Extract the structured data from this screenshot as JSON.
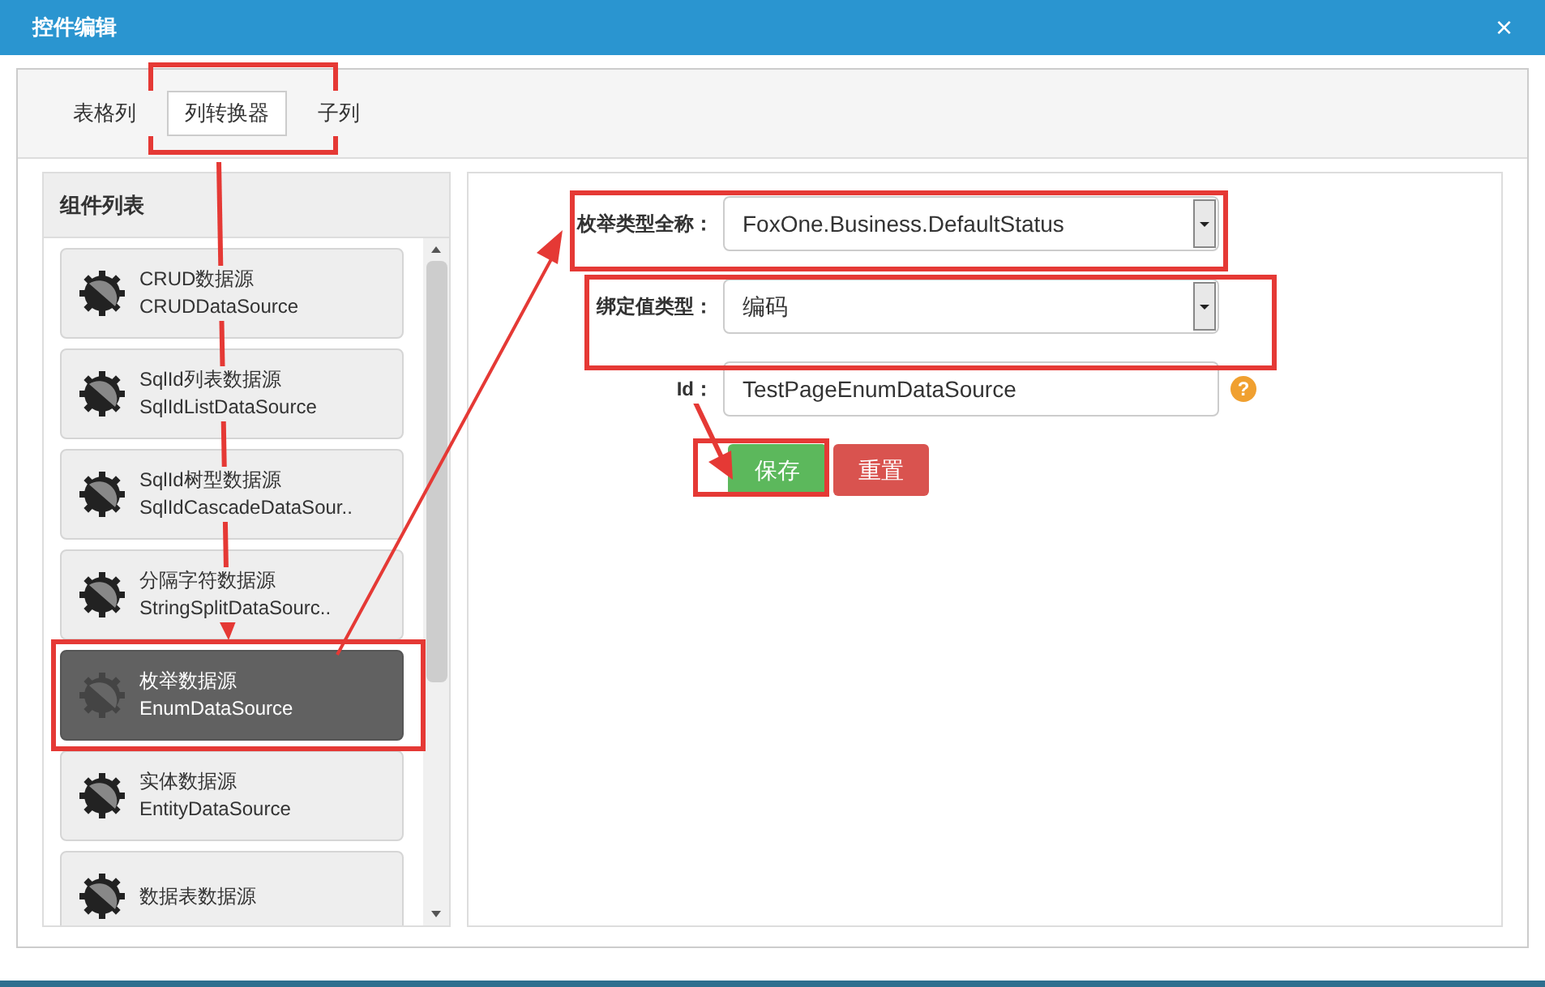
{
  "window": {
    "title": "控件编辑",
    "close": "×"
  },
  "tabs": [
    {
      "label": "表格列",
      "selected": false
    },
    {
      "label": "列转换器",
      "selected": true
    },
    {
      "label": "子列",
      "selected": false
    }
  ],
  "component_list": {
    "title": "组件列表",
    "items": [
      {
        "name": "CRUD数据源",
        "type": "CRUDDataSource",
        "selected": false
      },
      {
        "name": "SqlId列表数据源",
        "type": "SqlIdListDataSource",
        "selected": false
      },
      {
        "name": "SqlId树型数据源",
        "type": "SqlIdCascadeDataSour..",
        "selected": false
      },
      {
        "name": "分隔字符数据源",
        "type": "StringSplitDataSourc..",
        "selected": false
      },
      {
        "name": "枚举数据源",
        "type": "EnumDataSource",
        "selected": true
      },
      {
        "name": "实体数据源",
        "type": "EntityDataSource",
        "selected": false
      },
      {
        "name": "数据表数据源",
        "selected": false
      }
    ]
  },
  "form": {
    "fields": [
      {
        "kind": "select",
        "label": "枚举类型全称：",
        "value": "FoxOne.Business.DefaultStatus"
      },
      {
        "kind": "select",
        "label": "绑定值类型：",
        "value": "编码"
      },
      {
        "kind": "text",
        "label": "Id：",
        "value": "TestPageEnumDataSource",
        "help": "?"
      }
    ],
    "buttons": [
      {
        "kind": "save",
        "label": "保存"
      },
      {
        "kind": "reset",
        "label": "重置"
      }
    ]
  }
}
